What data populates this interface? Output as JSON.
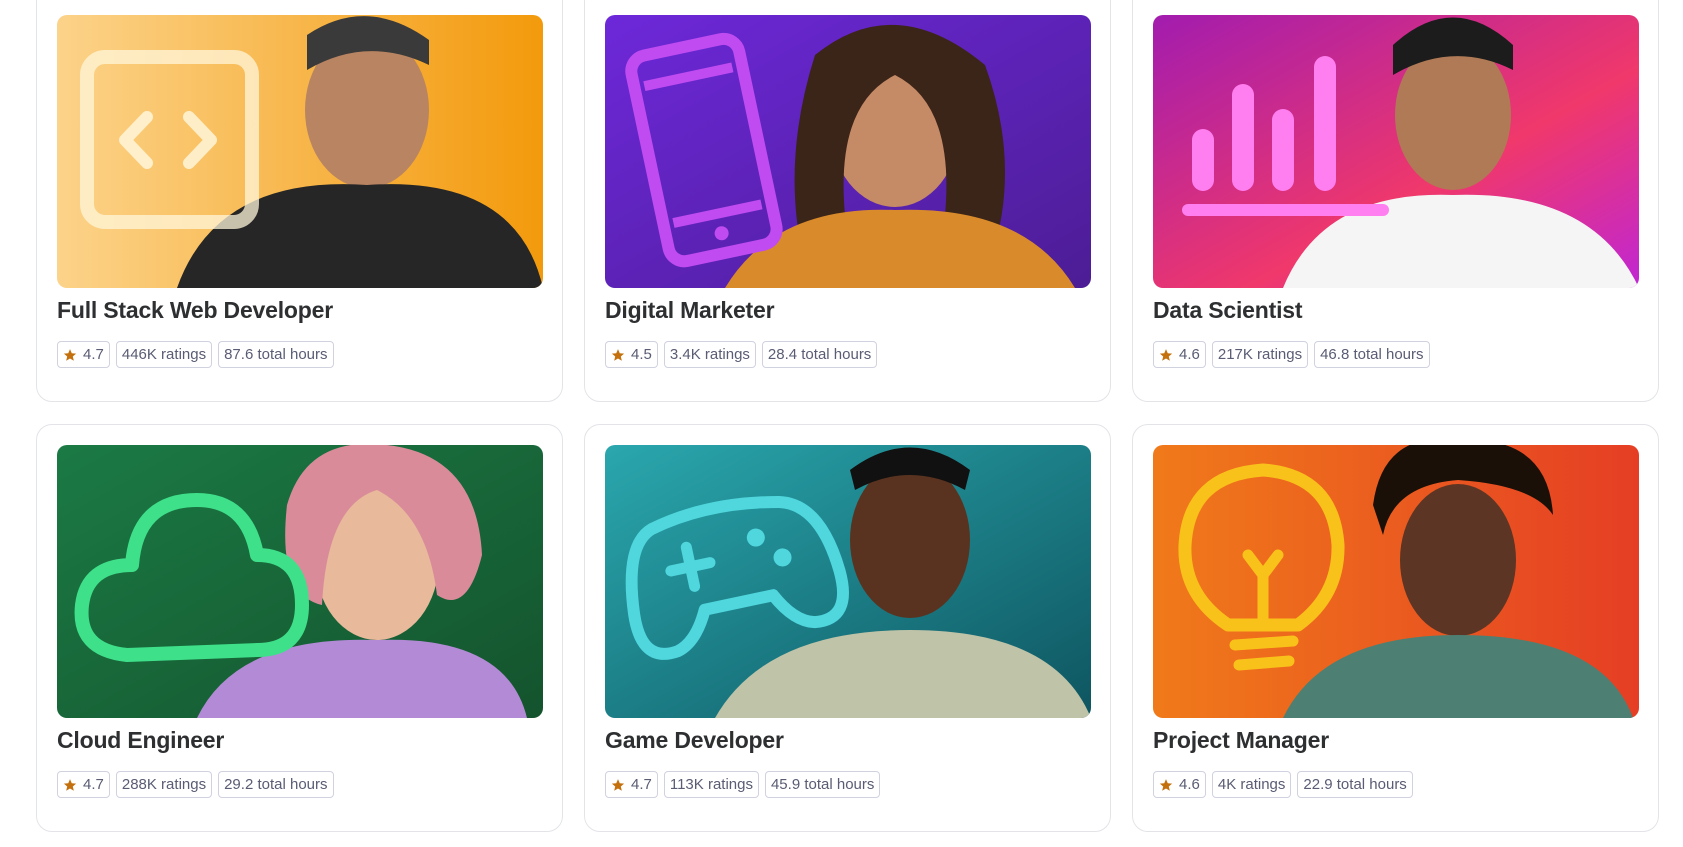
{
  "cards": [
    {
      "title": "Full Stack Web Developer",
      "rating": "4.7",
      "ratings_count": "446K ratings",
      "hours": "87.6 total hours",
      "icon": "code-icon",
      "accent": "#f4a21c"
    },
    {
      "title": "Digital Marketer",
      "rating": "4.5",
      "ratings_count": "3.4K ratings",
      "hours": "28.4 total hours",
      "icon": "smartphone-icon",
      "accent": "#5b21b6"
    },
    {
      "title": "Data Scientist",
      "rating": "4.6",
      "ratings_count": "217K ratings",
      "hours": "46.8 total hours",
      "icon": "bar-chart-icon",
      "accent": "#c026d3"
    },
    {
      "title": "Cloud Engineer",
      "rating": "4.7",
      "ratings_count": "288K ratings",
      "hours": "29.2 total hours",
      "icon": "cloud-icon",
      "accent": "#166534"
    },
    {
      "title": "Game Developer",
      "rating": "4.7",
      "ratings_count": "113K ratings",
      "hours": "45.9 total hours",
      "icon": "gamepad-icon",
      "accent": "#0f6e78"
    },
    {
      "title": "Project Manager",
      "rating": "4.6",
      "ratings_count": "4K ratings",
      "hours": "22.9 total hours",
      "icon": "lightbulb-icon",
      "accent": "#ea580c"
    }
  ],
  "colors": {
    "star": "#c4710d",
    "border": "#e3e4e8",
    "chip_border": "#d1d2e0"
  }
}
